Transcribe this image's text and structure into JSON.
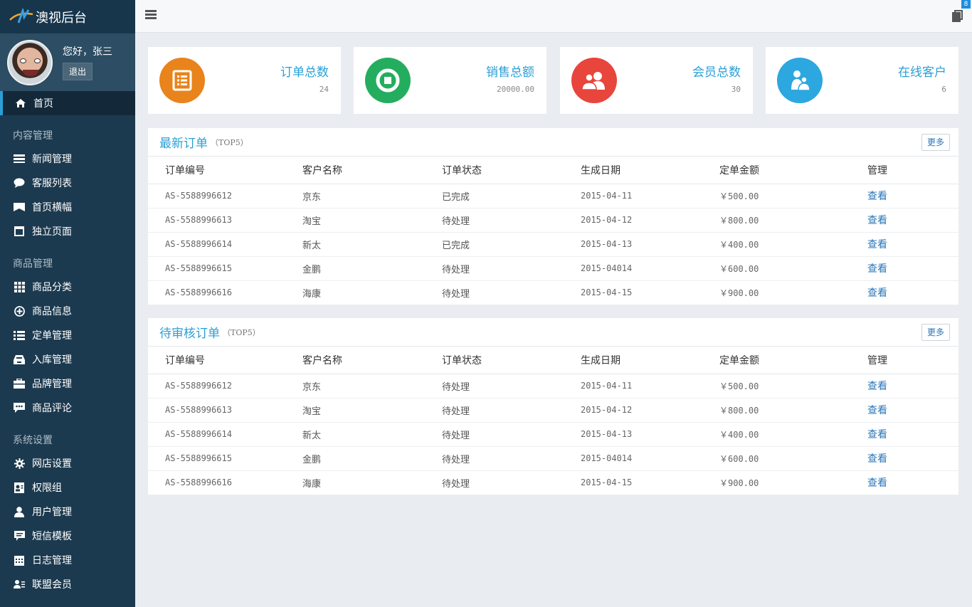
{
  "app": {
    "title": "澳视后台"
  },
  "user": {
    "greeting": "您好，张三",
    "logout_label": "退出"
  },
  "topbar": {
    "notif_count": "8"
  },
  "sidebar": {
    "home": "首页",
    "sections": [
      {
        "title": "内容管理",
        "items": [
          {
            "label": "新闻管理",
            "icon": "list-icon"
          },
          {
            "label": "客服列表",
            "icon": "chat-bubble-icon"
          },
          {
            "label": "首页横幅",
            "icon": "banner-icon"
          },
          {
            "label": "独立页面",
            "icon": "calendar-page-icon"
          }
        ]
      },
      {
        "title": "商品管理",
        "items": [
          {
            "label": "商品分类",
            "icon": "grid-icon"
          },
          {
            "label": "商品信息",
            "icon": "plus-circle-icon"
          },
          {
            "label": "定单管理",
            "icon": "list-bullets-icon"
          },
          {
            "label": "入库管理",
            "icon": "inbox-icon"
          },
          {
            "label": "品牌管理",
            "icon": "briefcase-icon"
          },
          {
            "label": "商品评论",
            "icon": "comment-dots-icon"
          }
        ]
      },
      {
        "title": "系统设置",
        "items": [
          {
            "label": "网店设置",
            "icon": "gear-icon"
          },
          {
            "label": "权限组",
            "icon": "id-card-icon"
          },
          {
            "label": "用户管理",
            "icon": "user-icon"
          },
          {
            "label": "短信模板",
            "icon": "message-icon"
          },
          {
            "label": "日志管理",
            "icon": "calendar-icon"
          },
          {
            "label": "联盟会员",
            "icon": "users-list-icon"
          }
        ]
      }
    ]
  },
  "stats": [
    {
      "title": "订单总数",
      "value": "24",
      "color": "#e8841b",
      "icon": "order-list-icon"
    },
    {
      "title": "销售总额",
      "value": "20000.00",
      "color": "#25ad5f",
      "icon": "stop-circle-icon"
    },
    {
      "title": "会员总数",
      "value": "30",
      "color": "#e8453c",
      "icon": "members-icon"
    },
    {
      "title": "在线客户",
      "value": "6",
      "color": "#2ca7e0",
      "icon": "online-users-icon"
    }
  ],
  "table_headers": [
    "订单编号",
    "客户名称",
    "订单状态",
    "生成日期",
    "定单金额",
    "管理"
  ],
  "latest_orders": {
    "title": "最新订单",
    "subtitle": "（TOP5）",
    "more": "更多",
    "rows": [
      [
        "AS-5588996612",
        "京东",
        "已完成",
        "2015-04-11",
        "￥500.00",
        "查看"
      ],
      [
        "AS-5588996613",
        "淘宝",
        "待处理",
        "2015-04-12",
        "￥800.00",
        "查看"
      ],
      [
        "AS-5588996614",
        "新太",
        "已完成",
        "2015-04-13",
        "￥400.00",
        "查看"
      ],
      [
        "AS-5588996615",
        "金鹏",
        "待处理",
        "2015-04014",
        "￥600.00",
        "查看"
      ],
      [
        "AS-5588996616",
        "海康",
        "待处理",
        "2015-04-15",
        "￥900.00",
        "查看"
      ]
    ]
  },
  "pending_orders": {
    "title": "待审核订单",
    "subtitle": "（TOP5）",
    "more": "更多",
    "rows": [
      [
        "AS-5588996612",
        "京东",
        "待处理",
        "2015-04-11",
        "￥500.00",
        "查看"
      ],
      [
        "AS-5588996613",
        "淘宝",
        "待处理",
        "2015-04-12",
        "￥800.00",
        "查看"
      ],
      [
        "AS-5588996614",
        "新太",
        "待处理",
        "2015-04-13",
        "￥400.00",
        "查看"
      ],
      [
        "AS-5588996615",
        "金鹏",
        "待处理",
        "2015-04014",
        "￥600.00",
        "查看"
      ],
      [
        "AS-5588996616",
        "海康",
        "待处理",
        "2015-04-15",
        "￥900.00",
        "查看"
      ]
    ]
  }
}
